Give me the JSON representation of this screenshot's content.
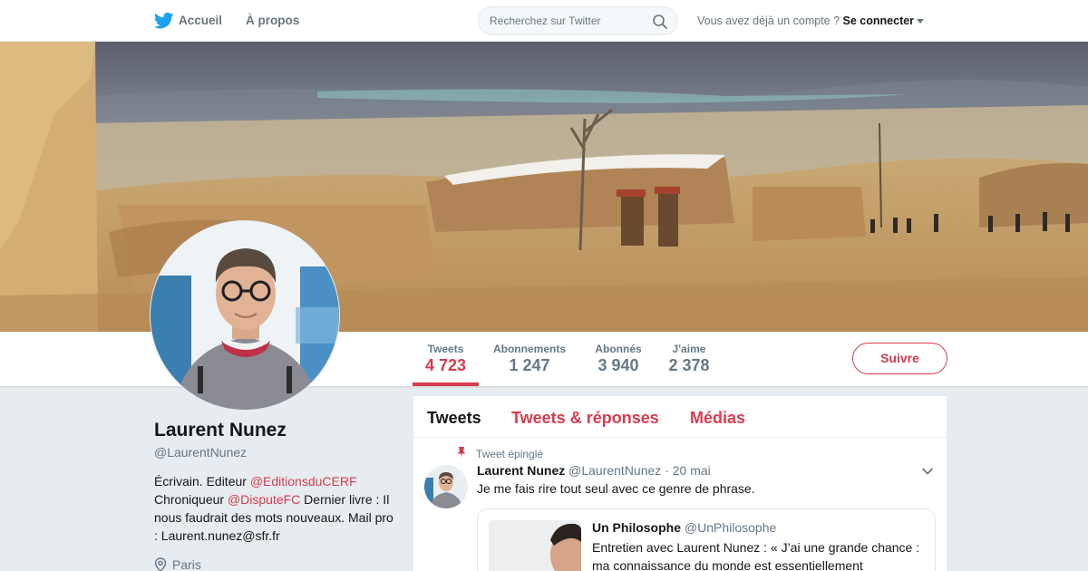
{
  "nav": {
    "home_label": "Accueil",
    "about_label": "À propos",
    "search_placeholder": "Recherchez sur Twitter",
    "login_prompt": "Vous avez déjà un compte ?",
    "login_link": "Se connecter"
  },
  "stats": {
    "tweets": {
      "label": "Tweets",
      "value": "4 723"
    },
    "following": {
      "label": "Abonnements",
      "value": "1 247"
    },
    "followers": {
      "label": "Abonnés",
      "value": "3 940"
    },
    "likes": {
      "label": "J'aime",
      "value": "2 378"
    },
    "active": "tweets"
  },
  "follow_button": "Suivre",
  "profile": {
    "name": "Laurent Nunez",
    "handle": "@LaurentNunez",
    "bio_part1": "Écrivain. Editeur ",
    "bio_link1": "@EditionsduCERF",
    "bio_part2": "Chroniqueur ",
    "bio_link2": "@DisputeFC",
    "bio_part3": " Dernier livre : Il nous faudrait des mots nouveaux. Mail pro : Laurent.nunez@sfr.fr",
    "location": "Paris"
  },
  "timeline": {
    "tabs": [
      {
        "label": "Tweets",
        "active": true
      },
      {
        "label": "Tweets & réponses",
        "active": false
      },
      {
        "label": "Médias",
        "active": false
      }
    ],
    "pinned_tweet": {
      "pinned_label": "Tweet épinglé",
      "author_name": "Laurent Nunez",
      "author_handle": "@LaurentNunez",
      "date": "· 20 mai",
      "text": "Je me fais rire tout seul avec ce genre de phrase.",
      "quote": {
        "author_name": "Un Philosophe",
        "author_handle": "@UnPhilosophe",
        "text": "Entretien avec Laurent Nunez : « J’ai une grande chance : ma connaissance du monde est essentiellement"
      }
    }
  },
  "colors": {
    "accent": "#d83b4e",
    "twitter_blue": "#1da1f2",
    "muted_text": "#657786",
    "page_background": "#e6ecf0"
  },
  "icons": [
    "twitter-bird-icon",
    "search-icon",
    "caret-down-icon",
    "location-pin-icon",
    "pushpin-icon",
    "chevron-down-icon"
  ]
}
